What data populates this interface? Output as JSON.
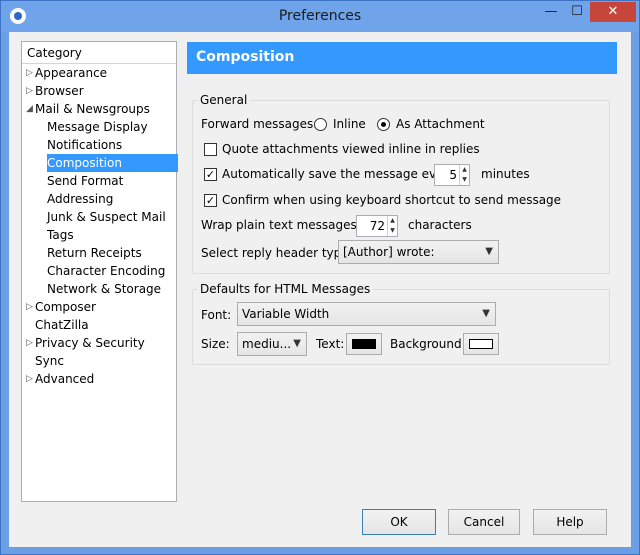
{
  "window": {
    "title": "Preferences",
    "min_glyph": "—",
    "max_glyph": "☐",
    "close_glyph": "✕"
  },
  "tree": {
    "header": "Category",
    "items": [
      {
        "label": "Appearance",
        "level": 0,
        "expandable": true
      },
      {
        "label": "Browser",
        "level": 0,
        "expandable": true
      },
      {
        "label": "Mail & Newsgroups",
        "level": 0,
        "expanded": true
      },
      {
        "label": "Message Display",
        "level": 1
      },
      {
        "label": "Notifications",
        "level": 1
      },
      {
        "label": "Composition",
        "level": 1,
        "selected": true
      },
      {
        "label": "Send Format",
        "level": 1
      },
      {
        "label": "Addressing",
        "level": 1
      },
      {
        "label": "Junk & Suspect Mail",
        "level": 1
      },
      {
        "label": "Tags",
        "level": 1
      },
      {
        "label": "Return Receipts",
        "level": 1
      },
      {
        "label": "Character Encoding",
        "level": 1
      },
      {
        "label": "Network & Storage",
        "level": 1
      },
      {
        "label": "Composer",
        "level": 0,
        "expandable": true
      },
      {
        "label": "ChatZilla",
        "level": 0
      },
      {
        "label": "Privacy & Security",
        "level": 0,
        "expandable": true
      },
      {
        "label": "Sync",
        "level": 0
      },
      {
        "label": "Advanced",
        "level": 0,
        "expandable": true
      }
    ]
  },
  "panel": {
    "title": "Composition"
  },
  "general": {
    "legend": "General",
    "forward_label": "Forward messages:",
    "forward_inline": "Inline",
    "forward_attachment": "As Attachment",
    "forward_selected": "As Attachment",
    "quote_label": "Quote attachments viewed inline in replies",
    "quote_checked": false,
    "autosave_label": "Automatically save the message every",
    "autosave_checked": true,
    "autosave_value": "5",
    "autosave_unit": "minutes",
    "confirm_label": "Confirm when using keyboard shortcut to send message",
    "confirm_checked": true,
    "wrap_label": "Wrap plain text messages at",
    "wrap_value": "72",
    "wrap_unit": "characters",
    "reply_header_label": "Select reply header type:",
    "reply_header_value": "[Author] wrote:"
  },
  "html_defaults": {
    "legend": "Defaults for HTML Messages",
    "font_label": "Font:",
    "font_value": "Variable Width",
    "size_label": "Size:",
    "size_value": "mediu...",
    "text_label": "Text:",
    "text_color": "#000000",
    "background_label": "Background:",
    "background_color": "#ffffff"
  },
  "buttons": {
    "ok": "OK",
    "cancel": "Cancel",
    "help": "Help"
  },
  "colors": {
    "accent": "#3399ff",
    "titlebar": "#6fa4ea",
    "close": "#c7463c"
  }
}
